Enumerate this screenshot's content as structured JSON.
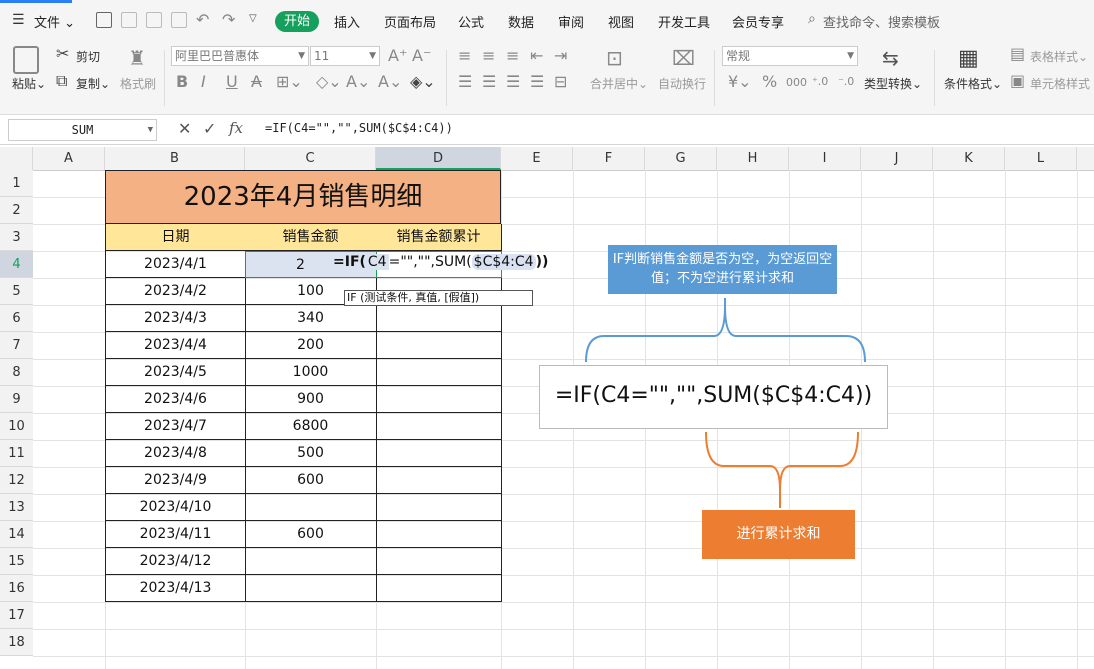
{
  "menubar": {
    "file_label": "文件",
    "tabs": [
      "开始",
      "插入",
      "页面布局",
      "公式",
      "数据",
      "审阅",
      "视图",
      "开发工具",
      "会员专享"
    ],
    "search_text": "查找命令、搜索模板"
  },
  "ribbon": {
    "paste": "粘贴",
    "cut": "剪切",
    "copy": "复制",
    "format_painter": "格式刷",
    "font_name": "阿里巴巴普惠体",
    "font_size": "11",
    "merge_center": "合并居中",
    "wrap_text": "自动换行",
    "number_format": "常规",
    "type_convert": "类型转换",
    "cond_format": "条件格式",
    "table_style": "表格样式",
    "cell_style": "单元格样式"
  },
  "formula_bar": {
    "name_box": "SUM",
    "formula": "=IF(C4=\"\",\"\",SUM($C$4:C4))"
  },
  "columns": [
    "A",
    "B",
    "C",
    "D",
    "E",
    "F",
    "G",
    "H",
    "I",
    "J",
    "K",
    "L"
  ],
  "rows": [
    "1",
    "2",
    "3",
    "4",
    "5",
    "6",
    "7",
    "8",
    "9",
    "10",
    "11",
    "12",
    "13",
    "14",
    "15",
    "16",
    "17",
    "18"
  ],
  "table": {
    "title": "2023年4月销售明细",
    "headers": [
      "日期",
      "销售金额",
      "销售金额累计"
    ],
    "dates": [
      "2023/4/1",
      "2023/4/2",
      "2023/4/3",
      "2023/4/4",
      "2023/4/5",
      "2023/4/6",
      "2023/4/7",
      "2023/4/8",
      "2023/4/9",
      "2023/4/10",
      "2023/4/11",
      "2023/4/12",
      "2023/4/13"
    ],
    "amounts": [
      "2",
      "100",
      "340",
      "200",
      "1000",
      "900",
      "6800",
      "500",
      "600",
      "",
      "600",
      "",
      ""
    ]
  },
  "editing": {
    "prefix": "=IF(",
    "ref1": "C4",
    "middle": "=\"\",\"\",SUM(",
    "ref2": "$C$4:C4",
    "suffix": "))",
    "tooltip": "IF (测试条件, 真值, [假值])"
  },
  "annotations": {
    "blue_note": "IF判断销售金额是否为空，为空返回空值；不为空进行累计求和",
    "formula_big": "=IF(C4=\"\",\"\",SUM($C$4:C4))",
    "orange_note": "进行累计求和"
  },
  "colors": {
    "accent": "#16a05d",
    "title_fill": "#f4b183",
    "header_fill": "#ffe699",
    "blue": "#5b9bd5",
    "orange": "#ed7d31"
  }
}
